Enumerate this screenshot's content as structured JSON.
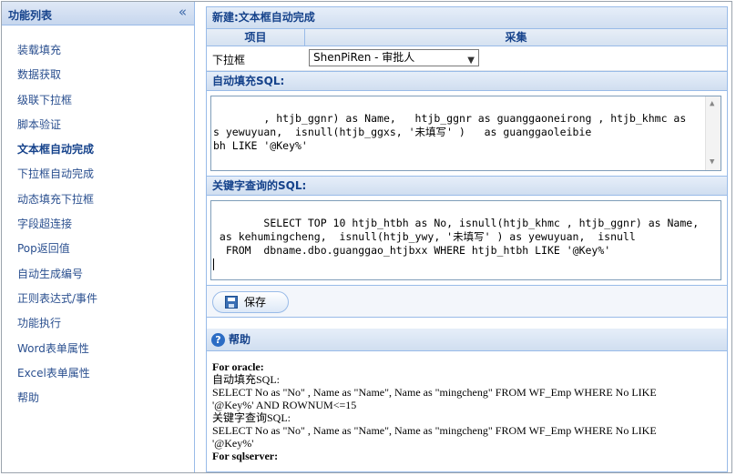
{
  "sidebar": {
    "title": "功能列表",
    "collapse_glyph": "«",
    "items": [
      {
        "label": "装载填充"
      },
      {
        "label": "数据获取"
      },
      {
        "label": "级联下拉框"
      },
      {
        "label": "脚本验证"
      },
      {
        "label": "文本框自动完成"
      },
      {
        "label": "下拉框自动完成"
      },
      {
        "label": "动态填充下拉框"
      },
      {
        "label": "字段超连接"
      },
      {
        "label": "Pop返回值"
      },
      {
        "label": "自动生成编号"
      },
      {
        "label": "正则表达式/事件"
      },
      {
        "label": "功能执行"
      },
      {
        "label": "Word表单属性"
      },
      {
        "label": "Excel表单属性"
      },
      {
        "label": "帮助"
      }
    ],
    "active_index": 4
  },
  "panel": {
    "title": "新建:文本框自动完成",
    "col_item": "项目",
    "col_collect": "采集",
    "dropdown_label": "下拉框",
    "dropdown_value": "ShenPiRen - 审批人",
    "autofill_label": "自动填充SQL:",
    "autofill_sql": ", htjb_ggnr) as Name,   htjb_ggnr as guanggaoneirong , htjb_khmc as\ns yewuyuan,  isnull(htjb_ggxs, '未填写' )   as guanggaoleibie\nbh LIKE '@Key%'",
    "keyword_label": "关键字查询的SQL:",
    "keyword_sql": "SELECT TOP 10 htjb_htbh as No, isnull(htjb_khmc , htjb_ggnr) as Name,\n as kehumingcheng,  isnull(htjb_ywy, '未填写' ) as yewuyuan,  isnull\n  FROM  dbname.dbo.guanggao_htjbxx WHERE htjb_htbh LIKE '@Key%'",
    "save_label": "保存"
  },
  "help": {
    "title": "帮助",
    "lines": [
      {
        "text": "For oracle:",
        "bold": true
      },
      {
        "text": "自动填充SQL:",
        "bold": false
      },
      {
        "text": "SELECT No as \"No\" , Name as \"Name\", Name as \"mingcheng\" FROM WF_Emp WHERE No LIKE",
        "bold": false
      },
      {
        "text": "'@Key%' AND ROWNUM<=15",
        "bold": false
      },
      {
        "text": "关键字查询SQL:",
        "bold": false
      },
      {
        "text": "SELECT No as \"No\" , Name as \"Name\", Name as \"mingcheng\" FROM WF_Emp WHERE No LIKE",
        "bold": false
      },
      {
        "text": "'@Key%'",
        "bold": false
      },
      {
        "text": "For sqlserver:",
        "bold": true
      }
    ]
  },
  "colors": {
    "header_text": "#15428b",
    "border": "#99bbe8",
    "link": "#2a4f8f"
  }
}
